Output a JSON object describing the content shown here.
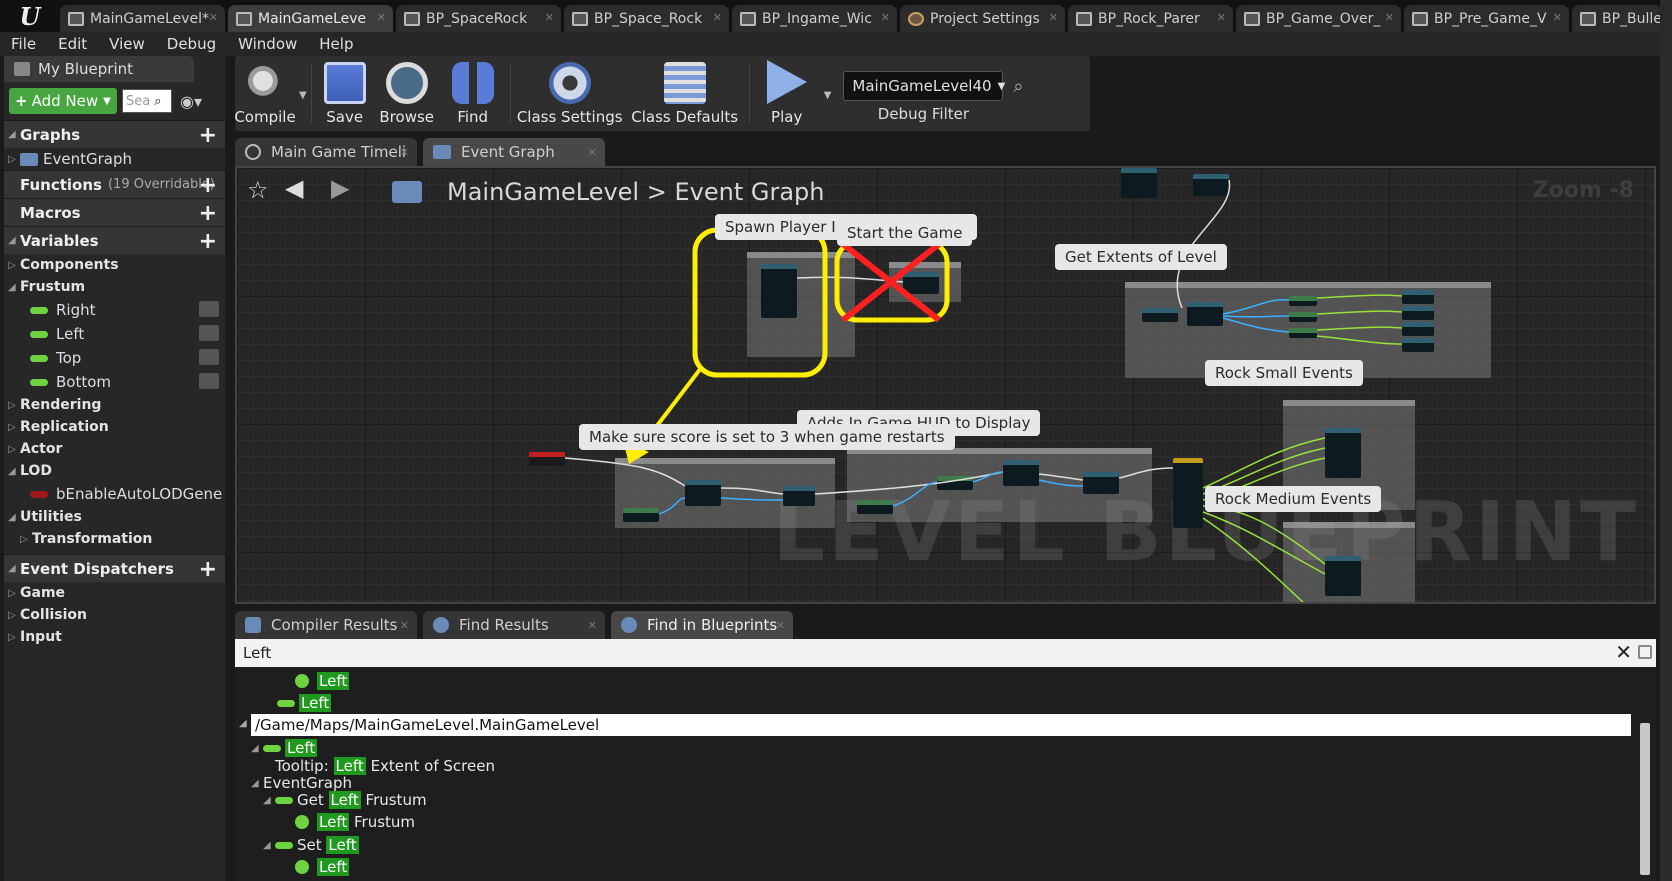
{
  "doc_tabs": [
    {
      "label": "MainGameLevel*",
      "active": false,
      "icon": "map-icon"
    },
    {
      "label": "MainGameLeve",
      "active": true,
      "icon": "blueprint-icon"
    },
    {
      "label": "BP_SpaceRock",
      "active": false,
      "icon": "blueprint-icon"
    },
    {
      "label": "BP_Space_Rock",
      "active": false,
      "icon": "blueprint-icon"
    },
    {
      "label": "BP_Ingame_Wic",
      "active": false,
      "icon": "widget-icon"
    },
    {
      "label": "Project Settings",
      "active": false,
      "icon": "gear-icon"
    },
    {
      "label": "BP_Rock_Parer",
      "active": false,
      "icon": "blueprint-icon"
    },
    {
      "label": "BP_Game_Over_",
      "active": false,
      "icon": "widget-icon"
    },
    {
      "label": "BP_Pre_Game_V",
      "active": false,
      "icon": "widget-icon"
    },
    {
      "label": "BP_Bulle",
      "active": false,
      "icon": "blueprint-icon"
    }
  ],
  "menu": [
    "File",
    "Edit",
    "View",
    "Debug",
    "Window",
    "Help"
  ],
  "my_blueprint": {
    "title": "My Blueprint",
    "add_new": "Add New",
    "search_placeholder": "Sea",
    "graphs": "Graphs",
    "event_graph": "EventGraph",
    "functions": "Functions",
    "functions_sub": "(19 Overridable)",
    "macros": "Macros",
    "variables": "Variables",
    "components": "Components",
    "frustum": "Frustum",
    "frustum_vars": [
      "Right",
      "Left",
      "Top",
      "Bottom"
    ],
    "rendering": "Rendering",
    "replication": "Replication",
    "actor": "Actor",
    "lod": "LOD",
    "lod_var": "bEnableAutoLODGene",
    "utilities": "Utilities",
    "transformation": "Transformation",
    "event_dispatchers": "Event Dispatchers",
    "dispatchers": [
      "Game",
      "Collision",
      "Input"
    ]
  },
  "toolbar": {
    "compile": "Compile",
    "save": "Save",
    "browse": "Browse",
    "find": "Find",
    "class_settings": "Class Settings",
    "class_defaults": "Class Defaults",
    "play": "Play",
    "debug_value": "MainGameLevel40",
    "debug_filter": "Debug Filter"
  },
  "graph_tabs": [
    "Main Game Timeli",
    "Event Graph"
  ],
  "graph": {
    "crumb_root": "MainGameLevel",
    "crumb_sep": ">",
    "crumb_leaf": "Event Graph",
    "zoom": "Zoom -8",
    "watermark": "LEVEL BLUEPRINT",
    "comments": {
      "spawn": "Spawn Player In Center Of Level",
      "start": "Start the Game",
      "extents": "Get Extents of Level",
      "rock_small": "Rock Small Events",
      "hud": "Adds In Game HUD to Display",
      "score": "Make sure score is set to 3 when game restarts",
      "rock_medium": "Rock Medium Events"
    }
  },
  "bottom_tabs": [
    "Compiler Results",
    "Find Results",
    "Find in Blueprints"
  ],
  "find": {
    "query": "Left",
    "path": "/Game/Maps/MainGameLevel.MainGameLevel",
    "left": "Left",
    "tooltip_prefix": "Tooltip:",
    "tooltip_rest": "Extent of Screen",
    "event_graph": "EventGraph",
    "get": "Get",
    "set": "Set",
    "frustum": "Frustum"
  },
  "colors": {
    "accent_green": "#47a640",
    "highlight": "#1f9a1f",
    "annotation_yellow": "#ffee00",
    "annotation_red": "#ff2020"
  }
}
